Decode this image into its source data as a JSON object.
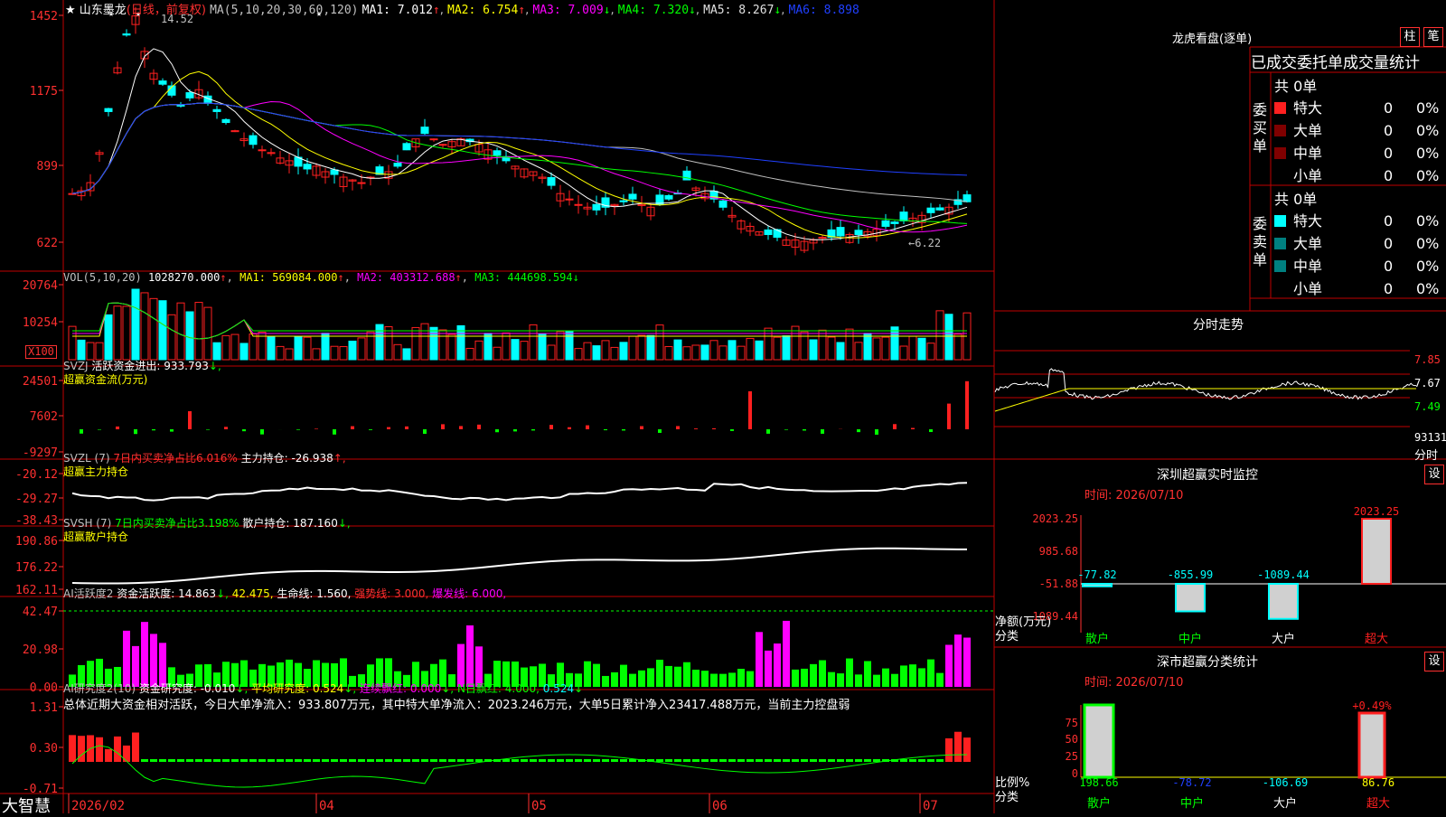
{
  "colors": {
    "up": "#ff2020",
    "down": "#00ffff",
    "grid": "#c00000",
    "axis": "#ff3030",
    "white": "#ffffff",
    "yellow": "#ffff00",
    "magenta": "#ff00ff",
    "green": "#00ff00",
    "gray": "#c0c0c0",
    "blue": "#2040ff",
    "deepred": "#800000",
    "teal": "#008080"
  },
  "main": {
    "title": "山东墨龙",
    "period": "(日线，前复权)",
    "ma_label": "MA(5,10,20,30,60,120)",
    "ma": [
      {
        "name": "MA1:",
        "value": "7.012",
        "arrow": "↑"
      },
      {
        "name": "MA2:",
        "value": "6.754",
        "arrow": "↑"
      },
      {
        "name": "MA3:",
        "value": "7.009",
        "arrow": "↓"
      },
      {
        "name": "MA4:",
        "value": "7.320",
        "arrow": "↓"
      },
      {
        "name": "MA5:",
        "value": "8.267",
        "arrow": "↓"
      },
      {
        "name": "MA6:",
        "value": "8.898",
        "arrow": ""
      }
    ],
    "yticks": [
      "1452",
      "1175",
      "899",
      "622"
    ],
    "high_label": "14.52",
    "low_label": "6.22",
    "xticks": [
      "2026/02",
      "04",
      "05",
      "06",
      "07"
    ]
  },
  "vol": {
    "label": "VOL(5,10,20)",
    "value": "1028270.000",
    "arrow": "↑",
    "ma1": "MA1: 569084.000",
    "ma1a": "↑",
    "ma2": "MA2: 403312.688",
    "ma2a": "↑",
    "ma3": "MA3: 444698.594",
    "ma3a": "↓",
    "yticks": [
      "20764",
      "10254"
    ],
    "unit": "X100"
  },
  "svzj": {
    "label": "SVZJ",
    "desc": "活跃资金进出: 933.793",
    "arrow": "↓,",
    "sub": "超赢资金流(万元)",
    "yticks": [
      "24501",
      "7602",
      "-9297"
    ]
  },
  "svzl": {
    "label": "SVZL (7)",
    "pct": "7日内买卖净占比6.016%",
    "hold": "主力持仓: -26.938",
    "arrow": "↑,",
    "sub": "超赢主力持仓",
    "yticks": [
      "-20.12",
      "-29.27",
      "-38.43"
    ]
  },
  "svsh": {
    "label": "SVSH (7)",
    "pct": "7日内买卖净占比3.198%",
    "hold": "散户持仓: 187.160",
    "arrow": "↓,",
    "sub": "超赢散户持仓",
    "yticks": [
      "190.86",
      "176.22",
      "162.11"
    ]
  },
  "ai1": {
    "label": "AI活跃度2",
    "a": "资金活跃度: 14.863",
    "aa": "↓,",
    "b": "42.475,",
    "c": "生命线: 1.560,",
    "d": "强势线: 3.000,",
    "e": "爆发线: 6.000,",
    "yticks": [
      "42.47",
      "20.98",
      "0.00"
    ]
  },
  "ai2": {
    "label": "AI研究度2(10)",
    "a": "资金研究度: -0.010",
    "aa": "↓,",
    "b": "平均研究度: 0.524",
    "ba": "↓,",
    "c": "连续飘红: 0.000",
    "ca": "↓,",
    "d": "N日飘红: 4.000,",
    "e": "0.524",
    "ea": "↓",
    "summary": "总体近期大资金相对活跃，今日大单净流入：933.807万元，其中特大单净流入：2023.246万元，大单5日累计净入23417.488万元，当前主力控盘弱",
    "yticks": [
      "1.31",
      "0.30",
      "-0.71"
    ]
  },
  "brand": "大智慧",
  "rp1": {
    "title": "龙虎看盘(逐单)",
    "btn1": "柱",
    "btn2": "笔",
    "header": "已成交委托单成交量统计",
    "buy_side": "委买单",
    "sell_side": "委卖单",
    "buy_total": "共 0单",
    "sell_total": "共 0单",
    "rows": [
      {
        "name": "特大",
        "v": "0",
        "p": "0%"
      },
      {
        "name": "大单",
        "v": "0",
        "p": "0%"
      },
      {
        "name": "中单",
        "v": "0",
        "p": "0%"
      },
      {
        "name": "小单",
        "v": "0",
        "p": "0%"
      }
    ]
  },
  "rp2": {
    "title": "分时走势",
    "yticks": [
      "7.85",
      "7.67",
      "7.49"
    ],
    "vol": "93131",
    "unit": "分时"
  },
  "rp3": {
    "title": "深圳超赢实时监控",
    "btn": "设",
    "time": "时间: 2026/07/10",
    "yticks": [
      "2023.25",
      "985.68",
      "-51.88",
      "-1089.44"
    ],
    "bars": [
      {
        "cat": "散户",
        "val": "-77.82"
      },
      {
        "cat": "中户",
        "val": "-855.99"
      },
      {
        "cat": "大户",
        "val": "-1089.44"
      },
      {
        "cat": "超大",
        "val": "2023.25"
      }
    ],
    "ylab1": "净额(万元)",
    "ylab2": "分类"
  },
  "rp4": {
    "title": "深市超赢分类统计",
    "btn": "设",
    "time": "时间: 2026/07/10",
    "yticks": [
      "75",
      "50",
      "25",
      "0"
    ],
    "top": "+0.49%",
    "bars": [
      {
        "cat": "散户",
        "val": "198.66"
      },
      {
        "cat": "中户",
        "val": "-78.72"
      },
      {
        "cat": "大户",
        "val": "-106.69"
      },
      {
        "cat": "超大",
        "val": "86.76"
      }
    ],
    "ylab1": "比例%",
    "ylab2": "分类"
  }
}
